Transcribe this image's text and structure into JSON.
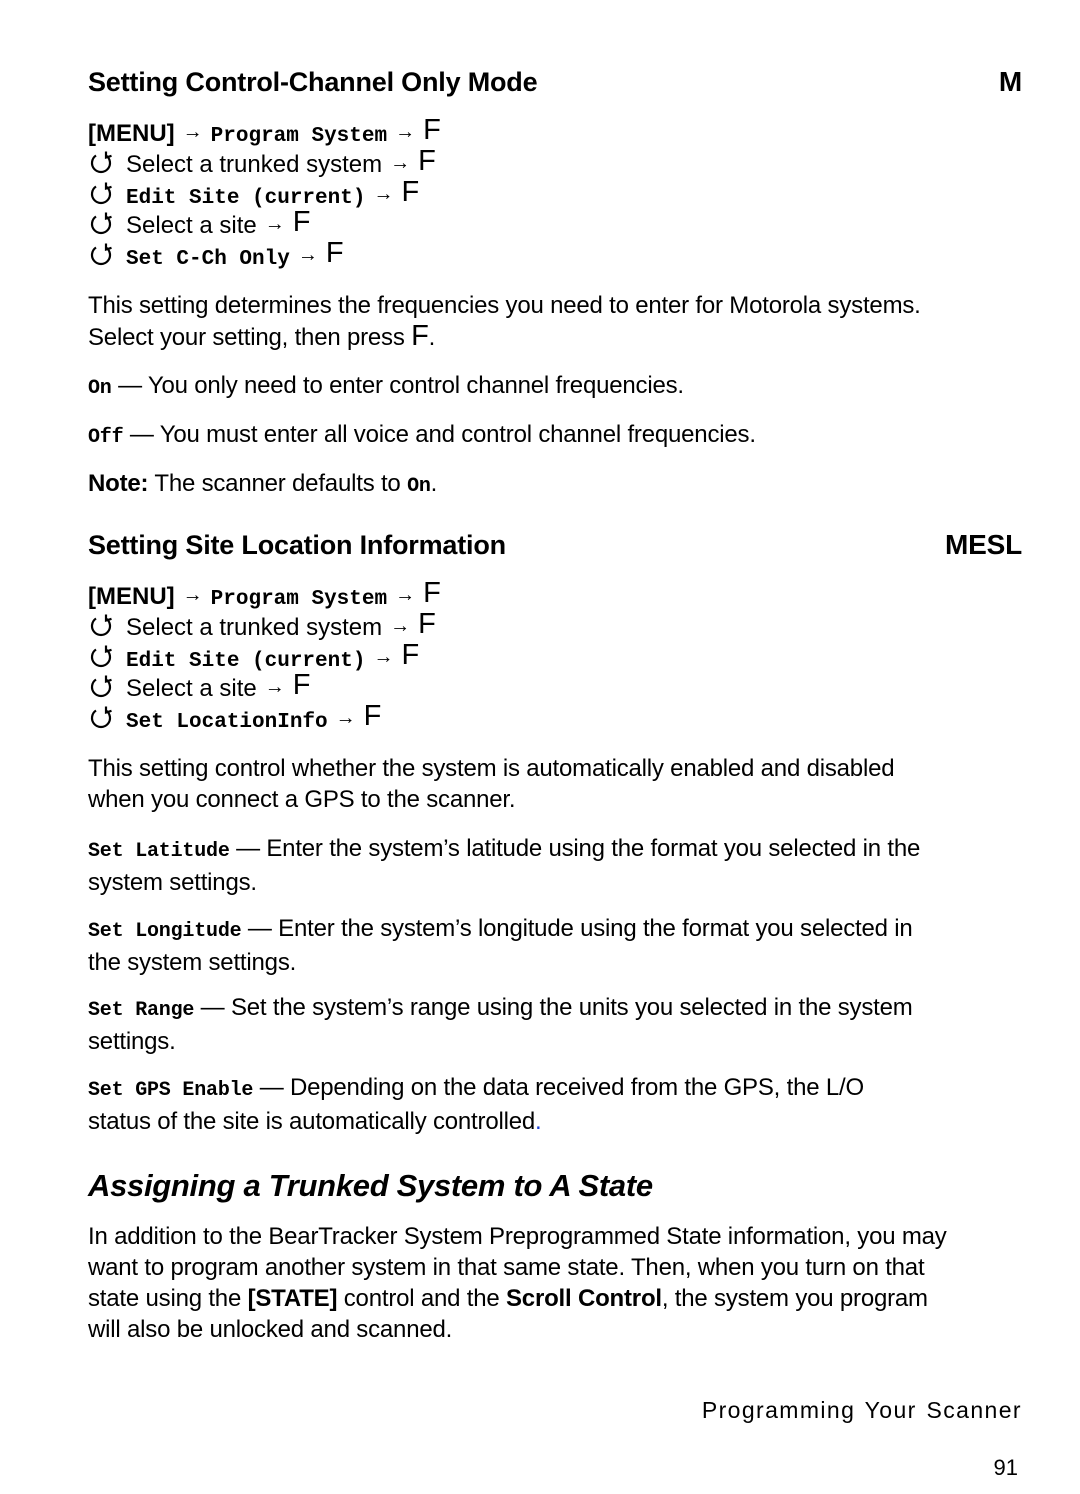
{
  "section1": {
    "title": "Setting Control-Channel Only Mode",
    "mode_tag": "M",
    "steps": [
      {
        "prefix": "[MENU]",
        "prefix_style": "bold",
        "text": "Program System",
        "text_style": "mono",
        "key": "F",
        "icon": null
      },
      {
        "prefix": null,
        "text": "Select a trunked system",
        "text_style": "normal",
        "key": "F",
        "icon": "scroll-control-icon"
      },
      {
        "prefix": null,
        "text": "Edit Site (current)",
        "text_style": "mono",
        "key": "F",
        "icon": "scroll-control-icon"
      },
      {
        "prefix": null,
        "text": "Select a site",
        "text_style": "normal",
        "key": "F",
        "icon": "scroll-control-icon"
      },
      {
        "prefix": null,
        "text": "Set C-Ch Only",
        "text_style": "mono",
        "key": "F",
        "icon": "scroll-control-icon"
      }
    ],
    "description_line1": "This setting determines the frequencies you need to enter for Motorola systems.",
    "description_line2_pre": "Select your setting, then press ",
    "description_line2_key": "F",
    "description_line2_post": ".",
    "options": [
      {
        "term": "On",
        "text": " — You only need to enter control channel frequencies."
      },
      {
        "term": "Off",
        "text": " — You must enter all voice and control channel frequencies."
      }
    ],
    "note_label": "Note:",
    "note_text": " The scanner defaults to ",
    "note_value": "On",
    "note_end": "."
  },
  "section2": {
    "title": "Setting Site Location Information",
    "mode_tag": "MESL",
    "steps": [
      {
        "prefix": "[MENU]",
        "prefix_style": "bold",
        "text": "Program System",
        "text_style": "mono",
        "key": "F",
        "icon": null
      },
      {
        "prefix": null,
        "text": "Select a trunked system",
        "text_style": "normal",
        "key": "F",
        "icon": "scroll-control-icon"
      },
      {
        "prefix": null,
        "text": "Edit Site (current)",
        "text_style": "mono",
        "key": "F",
        "icon": "scroll-control-icon"
      },
      {
        "prefix": null,
        "text": "Select a site",
        "text_style": "normal",
        "key": "F",
        "icon": "scroll-control-icon"
      },
      {
        "prefix": null,
        "text": "Set LocationInfo",
        "text_style": "mono",
        "key": "F",
        "icon": "scroll-control-icon"
      }
    ],
    "description_line1": "This setting control whether the system is automatically enabled and disabled",
    "description_line2": "when you connect a GPS to the scanner.",
    "items": [
      {
        "term": "Set Latitude",
        "line1": " — Enter the system’s latitude using the format you selected in the",
        "line2": "system settings."
      },
      {
        "term": "Set Longitude",
        "line1": " — Enter the system’s longitude using the format you selected in",
        "line2": "the system settings."
      },
      {
        "term": "Set Range",
        "line1": " — Set the system’s range using the units you selected in the system",
        "line2": "settings."
      },
      {
        "term": "Set GPS Enable",
        "line1": " — Depending on the data received from the GPS, the L/O",
        "line2": "status of the site is automatically controlled",
        "line2_end": "."
      }
    ]
  },
  "section3": {
    "title": "Assigning a Trunked System to A State",
    "line1": "In addition to the BearTracker System Preprogrammed State information, you may",
    "line2": "want to program another system in that same state. Then, when you turn on that",
    "line3_pre": "state using the ",
    "line3_key": "[STATE]",
    "line3_mid": " control and the ",
    "line3_bold": "Scroll Control",
    "line3_post": ", the system you program",
    "line4": "will also be unlocked and scanned."
  },
  "footer": {
    "chapter": "Programming Your Scanner",
    "page_number": "91"
  },
  "glyphs": {
    "arrow": "→"
  },
  "colors": {
    "text": "#000000",
    "accent_dot": "#1a3fd4",
    "background": "#ffffff"
  }
}
